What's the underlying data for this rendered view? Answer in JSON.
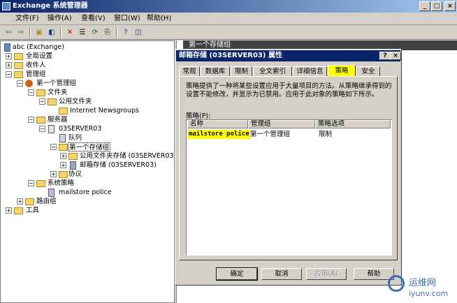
{
  "window": {
    "title": "Exchange 系统管理器",
    "min": "_",
    "max": "□",
    "close": "×"
  },
  "menu": [
    "文件(F)",
    "操作(A)",
    "查看(V)",
    "窗口(W)",
    "帮助(H)"
  ],
  "toolbar_icons": [
    "back-icon",
    "forward-icon",
    "up-icon",
    "show-hide-tree-icon",
    "delete-icon",
    "properties-icon",
    "refresh-icon",
    "export-icon",
    "help-icon",
    "new-window-icon"
  ],
  "tree": {
    "root": "abc (Exchange)",
    "global": "全局设置",
    "recipients": "收件人",
    "admin_groups": "管理组",
    "first_admin_group": "第一个管理组",
    "folders": "文件夹",
    "public_folders": "公用文件夹",
    "internet_newsgroups": "Internet Newsgroups",
    "servers": "服务器",
    "server": "03SERVER03",
    "queues": "队列",
    "first_storage_group": "第一个存储组",
    "public_store": "公用文件夹存储 (03SERVER03)",
    "mailbox_store": "邮箱存储 (03SERVER03)",
    "protocols": "协议",
    "system_policies": "系统策略",
    "mailstore_police": "mailstore police",
    "routing_groups": "路由组",
    "tools": "工具"
  },
  "right_pane_header": "第一个存储组",
  "dialog": {
    "title": "邮箱存储 (03SERVER03) 属性",
    "help_btn": "?",
    "close_btn": "×",
    "tabs": [
      "常规",
      "数据库",
      "限制",
      "全文索引",
      "详细信息",
      "策略",
      "安全"
    ],
    "active_tab": "策略",
    "description": "策略提供了一种将某些设置应用于大量项目的方法。从策略继承得到的设置不能修改，并显示为已禁用。应用于此对象的策略如下所示。",
    "policies_label": "策略(P):",
    "columns": [
      "名称",
      "管理组",
      "策略选项"
    ],
    "rows": [
      {
        "name": "mailstore police",
        "group": "第一个管理组",
        "options": "限制"
      }
    ],
    "buttons": {
      "ok": "确定",
      "cancel": "取消",
      "apply": "应用(A)",
      "help": "帮助"
    }
  },
  "watermark": {
    "cn": "运维网",
    "url": "iyunv.com"
  },
  "colors": {
    "titlebar": "#0a246a",
    "highlight": "#ffff00"
  }
}
